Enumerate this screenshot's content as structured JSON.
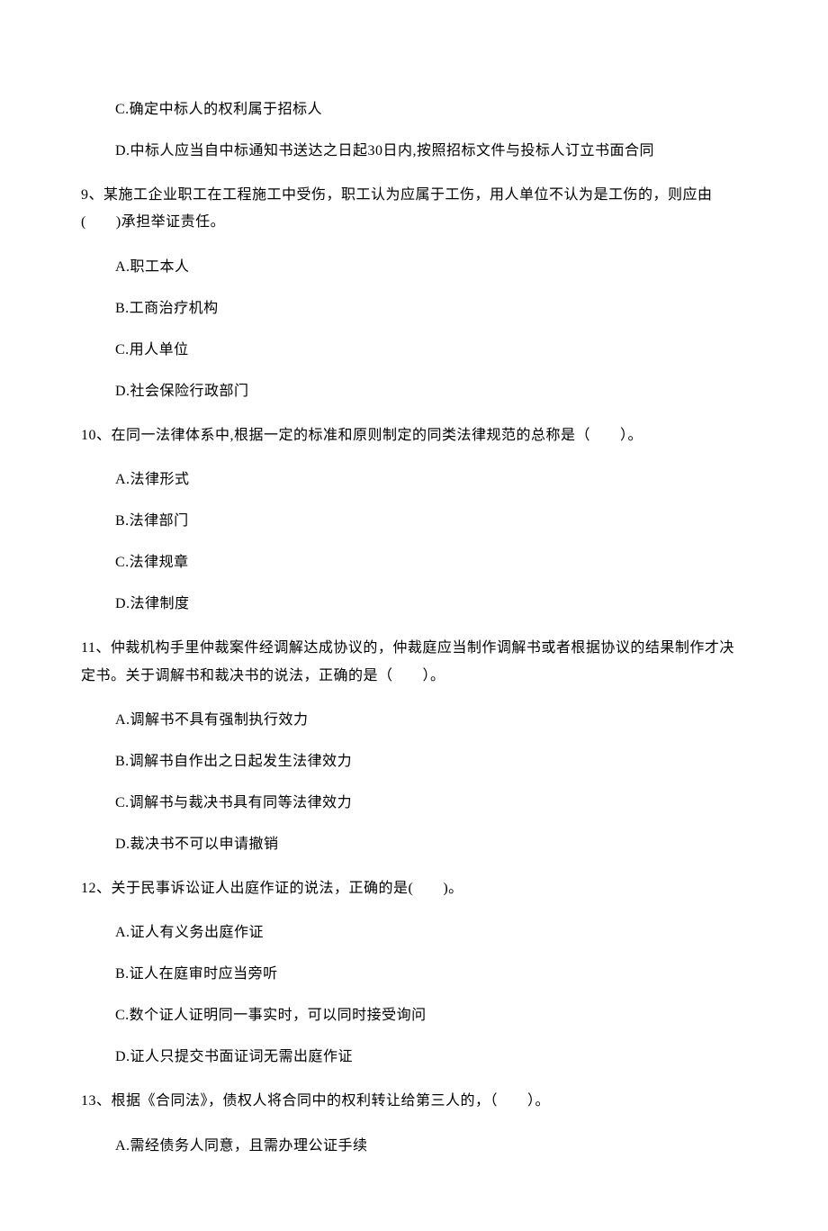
{
  "orphan_options": [
    "C.确定中标人的权利属于招标人",
    "D.中标人应当自中标通知书送达之日起30日内,按照招标文件与投标人订立书面合同"
  ],
  "questions": [
    {
      "stem": "9、某施工企业职工在工程施工中受伤，职工认为应属于工伤，用人单位不认为是工伤的，则应由(　　)承担举证责任。",
      "options": [
        "A.职工本人",
        "B.工商治疗机构",
        "C.用人单位",
        "D.社会保险行政部门"
      ]
    },
    {
      "stem": "10、在同一法律体系中,根据一定的标准和原则制定的同类法律规范的总称是（　　）。",
      "options": [
        "A.法律形式",
        "B.法律部门",
        "C.法律规章",
        "D.法律制度"
      ]
    },
    {
      "stem": "11、仲裁机构手里仲裁案件经调解达成协议的，仲裁庭应当制作调解书或者根据协议的结果制作才决定书。关于调解书和裁决书的说法，正确的是（　　）。",
      "options": [
        "A.调解书不具有强制执行效力",
        "B.调解书自作出之日起发生法律效力",
        "C.调解书与裁决书具有同等法律效力",
        "D.裁决书不可以申请撤销"
      ]
    },
    {
      "stem": "12、关于民事诉讼证人出庭作证的说法，正确的是(　　)。",
      "options": [
        "A.证人有义务出庭作证",
        "B.证人在庭审时应当旁听",
        "C.数个证人证明同一事实时，可以同时接受询问",
        "D.证人只提交书面证词无需出庭作证"
      ]
    },
    {
      "stem": "13、根据《合同法》，债权人将合同中的权利转让给第三人的，（　　）。",
      "options": [
        "A.需经债务人同意，且需办理公证手续"
      ]
    }
  ]
}
